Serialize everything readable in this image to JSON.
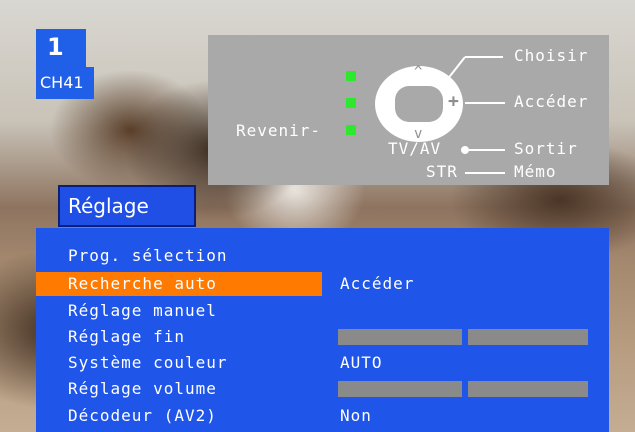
{
  "channel": {
    "number": "1",
    "name": "CH41"
  },
  "help": {
    "nav_left_label": "Revenir-",
    "choisir": "Choisir",
    "acceder": "Accéder",
    "tvav": "TV/AV",
    "sortir": "Sortir",
    "str": "STR",
    "memo": "Mémo",
    "dpad_up": "^",
    "dpad_down": "v",
    "dpad_plus": "+"
  },
  "menu": {
    "title": "Réglage",
    "items": [
      {
        "label": "Prog. sélection",
        "value": ""
      },
      {
        "label": "Recherche auto",
        "value": "Accéder",
        "selected": true
      },
      {
        "label": "Réglage manuel",
        "value": ""
      },
      {
        "label": "Réglage fin",
        "value": "",
        "bar": true
      },
      {
        "label": "Système couleur",
        "value": "AUTO"
      },
      {
        "label": "Réglage volume",
        "value": "",
        "bar": true
      },
      {
        "label": "Décodeur (AV2)",
        "value": "Non"
      }
    ]
  },
  "colors": {
    "menu_bg": "#1f55e8",
    "selected_bg": "#ff7a00",
    "help_bg": "#a9a9a9",
    "led": "#2ee82e"
  }
}
